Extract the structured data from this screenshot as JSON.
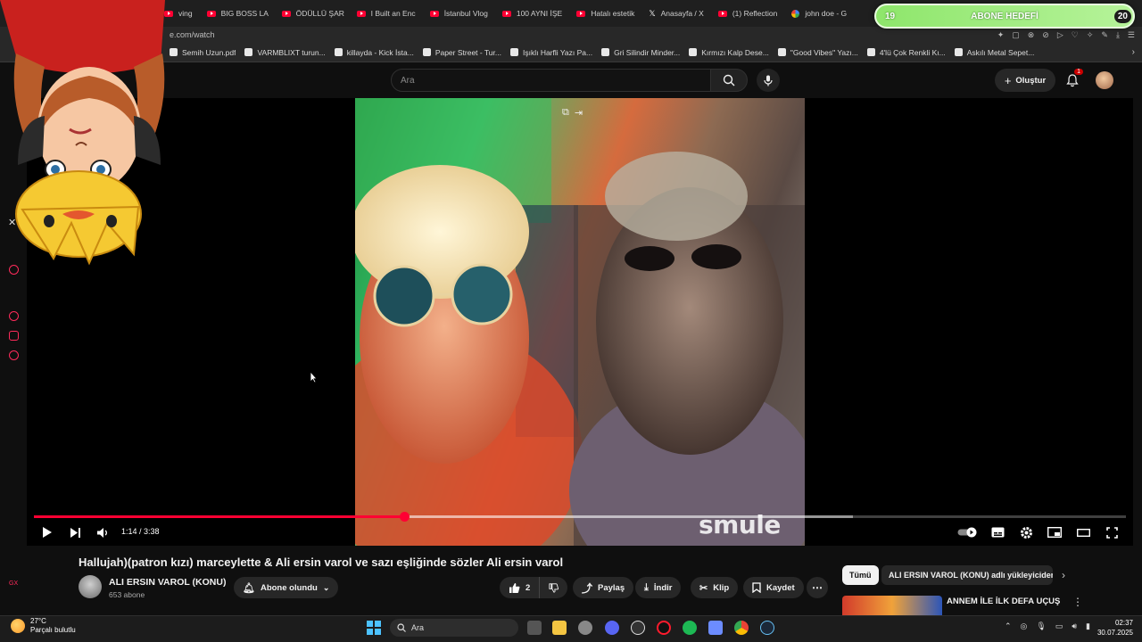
{
  "browser": {
    "tabs": [
      {
        "label": "ving ",
        "icon": "youtube-icon"
      },
      {
        "label": "BIG BOSS LA",
        "icon": "youtube-icon"
      },
      {
        "label": "ÖDÜLLÜ ŞAR",
        "icon": "youtube-icon"
      },
      {
        "label": "I Built an Enc",
        "icon": "youtube-icon"
      },
      {
        "label": "İstanbul Vlog",
        "icon": "youtube-icon"
      },
      {
        "label": "100 AYNI İŞE",
        "icon": "youtube-icon"
      },
      {
        "label": "Hatalı estetik",
        "icon": "youtube-icon"
      },
      {
        "label": "Anasayfa / X",
        "icon": "x-icon"
      },
      {
        "label": "(1) Reflection",
        "icon": "youtube-icon"
      },
      {
        "label": "john doe - G",
        "icon": "google-icon"
      }
    ],
    "url": "e.com/watch",
    "bookmarks": [
      "Semih Uzun.pdf",
      "VARMBLIXT turun...",
      "killayda - Kick İsta...",
      "Paper Street - Tur...",
      "Işıklı Harfli Yazı Pa...",
      "Gri Silindir Minder...",
      "Kırmızı Kalp Dese...",
      "\"Good Vibes\" Yazı...",
      "4'lü Çok Renkli Kı...",
      "Askılı Metal Sepet..."
    ]
  },
  "overlay": {
    "goal_label": "ABONE HEDEFİ",
    "goal_current": "19",
    "goal_target": "20",
    "goal_progress": 0.95
  },
  "youtube": {
    "search_placeholder": "Ara",
    "create_label": "Oluştur",
    "notifications": "1"
  },
  "player": {
    "time": "1:14 / 3:38",
    "watermark": "smule",
    "progress": 0.339,
    "buffered": 0.75
  },
  "video": {
    "title": "Hallujah)(patron kızı) marceylette & Ali ersin varol ve sazı eşliğinde sözler Ali ersin varol",
    "channel": "ALI ERSIN VAROL (KONU)",
    "subscribers": "653 abone",
    "subscribed_label": "Abone olundu",
    "likes": "2",
    "share_label": "Paylaş",
    "download_label": "İndir",
    "clip_label": "Klip",
    "save_label": "Kaydet"
  },
  "sidebar_right": {
    "chip_all": "Tümü",
    "chip_uploader": "ALI ERSIN VAROL (KONU) adlı yükleyiciden",
    "rec_title": "ANNEM İLE İLK DEFA UÇUŞ YAPTIK"
  },
  "taskbar": {
    "temp": "27°C",
    "weather": "Parçalı bulutlu",
    "search": "Ara",
    "time": "02:37",
    "date": "30.07.2025"
  }
}
